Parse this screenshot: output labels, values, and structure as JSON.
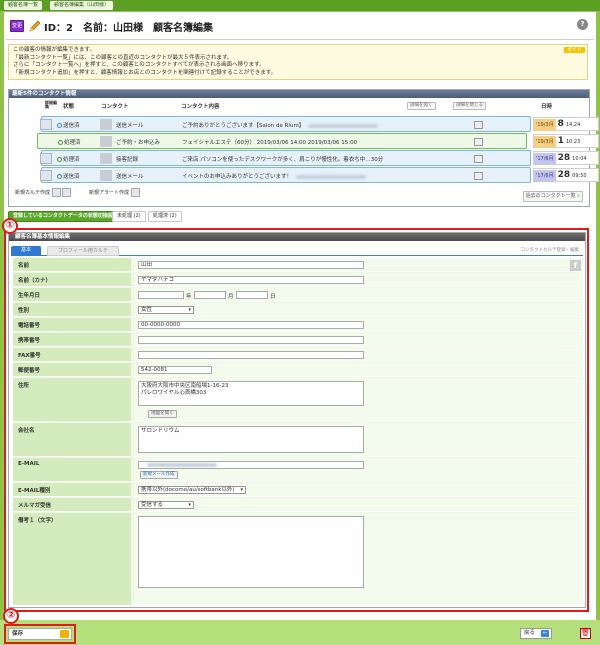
{
  "topbar": {
    "tab1": "顧客名簿一覧",
    "tab2": "顧客名簿編集（山田様）"
  },
  "header": {
    "badge": "変更",
    "title": "ID：2　名前：山田様　顧客名簿編集",
    "help": "?"
  },
  "notice": {
    "guide": "ガイド",
    "lines": [
      "この顧客の情報が編集できます。",
      "「最新コンタクト一覧」には、この顧客との直近のコンタクトが最大５件表示されます。",
      "さらに「コンタクト一覧へ」を押すと、この顧客とのコンタクトすべてが表示される画面へ移ります。",
      "「新規コンタクト追加」を押すと、顧客情報とお店とのコンタクトを関連付けて記録することができます。"
    ]
  },
  "contacts": {
    "section_title": "最新5件のコンタクト情報",
    "headers": {
      "edit": "詳細編集",
      "status": "状態",
      "contact": "コンタクト",
      "content": "コンタクト内容",
      "date": "日時"
    },
    "expand_all": "詳細を開く",
    "collapse_all": "詳細を閉じる",
    "rows": [
      {
        "status": "送信済",
        "type": "送信メール",
        "content": "ご予約ありがとうございます【Salon de Rium】",
        "year": "'19/3月",
        "day": "8",
        "time": "14:24"
      },
      {
        "status": "処理済",
        "type": "ご予約・お申込み",
        "content": "フェイシャルエステ（60分） 2019/03/06 14:00 2019/03/06 15:00",
        "year": "'19/3月",
        "day": "1",
        "time": "10:23"
      },
      {
        "status": "処理済",
        "type": "接客記録",
        "content": "ご来店 パソコンを使ったデスクワークが多く、肩こりが慢性化。着衣ち中…30分",
        "year": "'17/6月",
        "day": "28",
        "time": "10:04"
      },
      {
        "status": "送信済",
        "type": "送信メール",
        "content": "イベントのお申込みありがとうございます！",
        "year": "'17/6月",
        "day": "28",
        "time": "09:50"
      }
    ],
    "new_karte": "新規カルテ作成",
    "new_alert": "新規アラート作成",
    "past_contacts": "過去のコンタクト一覧"
  },
  "group_tabs": [
    "登録しているコンタクトデータの状態切換設定",
    "未処理 (2)",
    "処理済 (2)"
  ],
  "annotations": {
    "one": "①",
    "two": "②"
  },
  "form": {
    "section_title": "顧客名簿基本情報編集",
    "tabs": [
      "基本",
      "プロフィール用カルテ"
    ],
    "right_link": "コンタクトカルテ登録・編集",
    "fb_icon": "f",
    "labels": {
      "name": "名前",
      "kana": "名前（カナ）",
      "birthday": "生年月日",
      "gender": "性別",
      "phone": "電話番号",
      "mobile": "携帯番号",
      "fax": "FAX番号",
      "zip": "郵便番号",
      "address": "住所",
      "company": "会社名",
      "email": "E-MAIL",
      "email_type": "E-MAIL種別",
      "magazine": "メルマガ受信",
      "memo": "備考１（文字）"
    },
    "values": {
      "name": "山田",
      "kana": "ヤマダハナコ",
      "gender": "女性",
      "phone": "00-0000-0000",
      "zip": "542-0081",
      "address": "大阪府大阪市中央区南船場1-16-23\nパレロワイヤル心斎橋303",
      "company": "サロンドリウム",
      "email_type": "携帯以外(docomo/au/softbank以外)",
      "magazine": "受信する"
    },
    "birthday_units": {
      "year": "年",
      "month": "月",
      "day": "日"
    },
    "map_button": "地図を開く",
    "new_mail_button": "新規メール作成"
  },
  "footer": {
    "save": "保存",
    "back": "戻る",
    "back_arrow": "←",
    "trash": "🗑"
  }
}
